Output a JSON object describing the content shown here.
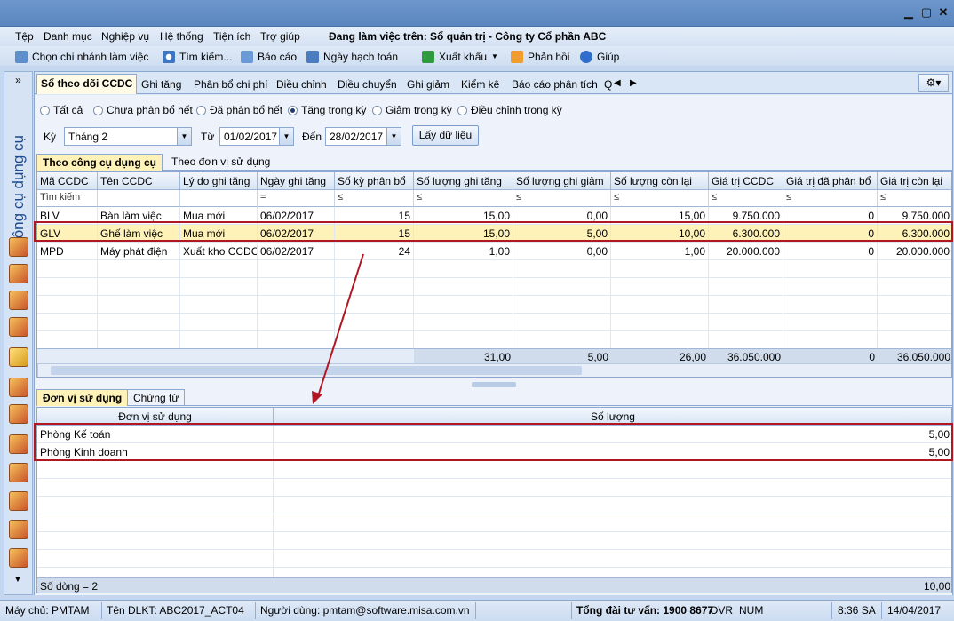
{
  "window": {
    "min": "▁",
    "max": "▢",
    "close": "✕"
  },
  "menu": {
    "items": [
      "Tệp",
      "Danh mục",
      "Nghiệp vụ",
      "Hệ thống",
      "Tiện ích",
      "Trợ giúp"
    ],
    "status": "Đang làm việc trên: Sổ quản trị - Công ty Cổ phần ABC"
  },
  "toolbar": {
    "branch": "Chọn chi nhánh làm việc",
    "search": "Tìm kiếm...",
    "report": "Báo cáo",
    "posting_date": "Ngày hạch toán",
    "export": "Xuất khẩu",
    "feedback": "Phản hồi",
    "help": "Giúp"
  },
  "left": {
    "title": "Công cụ dụng cụ",
    "collapse": "»"
  },
  "tabs": [
    "Sổ theo dõi CCDC",
    "Ghi tăng",
    "Phân bổ chi phí",
    "Điều chỉnh",
    "Điều chuyển",
    "Ghi giảm",
    "Kiểm kê",
    "Báo cáo phân tích",
    "Q"
  ],
  "filters": {
    "radios": [
      "Tất cả",
      "Chưa phân bổ hết",
      "Đã phân bổ hết",
      "Tăng trong kỳ",
      "Giảm trong kỳ",
      "Điều chỉnh trong kỳ"
    ],
    "selected": "Tăng trong kỳ",
    "period_label": "Kỳ",
    "period_value": "Tháng 2",
    "from_label": "Từ",
    "from_value": "01/02/2017",
    "to_label": "Đến",
    "to_value": "28/02/2017",
    "fetch_button": "Lấy dữ liệu"
  },
  "view_tabs": [
    "Theo công cụ dụng cụ",
    "Theo đơn vị sử dụng"
  ],
  "top_grid": {
    "headers": [
      "Mã CCDC",
      "Tên CCDC",
      "Lý do ghi tăng",
      "Ngày ghi tăng",
      "Số kỳ phân bổ",
      "Số lượng ghi tăng",
      "Số lượng ghi giảm",
      "Số lượng còn lại",
      "Giá trị CCDC",
      "Giá trị đã phân bổ",
      "Giá trị còn lại"
    ],
    "filter_row": [
      "Tìm kiếm",
      "",
      "",
      "=",
      "≤",
      "≤",
      "≤",
      "≤",
      "≤",
      "≤",
      "≤"
    ],
    "rows": [
      [
        "BLV",
        "Bàn làm việc",
        "Mua mới",
        "06/02/2017",
        "15",
        "15,00",
        "0,00",
        "15,00",
        "9.750.000",
        "0",
        "9.750.000"
      ],
      [
        "GLV",
        "Ghế làm việc",
        "Mua mới",
        "06/02/2017",
        "15",
        "15,00",
        "5,00",
        "10,00",
        "6.300.000",
        "0",
        "6.300.000"
      ],
      [
        "MPD",
        "Máy phát điện",
        "Xuất kho CCDC",
        "06/02/2017",
        "24",
        "1,00",
        "0,00",
        "1,00",
        "20.000.000",
        "0",
        "20.000.000"
      ]
    ],
    "selected_row": 1,
    "totals": [
      "",
      "",
      "",
      "",
      "",
      "31,00",
      "5,00",
      "26,00",
      "36.050.000",
      "0",
      "36.050.000"
    ]
  },
  "detail_tabs": [
    "Đơn vị sử dụng",
    "Chứng từ"
  ],
  "bottom_grid": {
    "headers": [
      "Đơn vị sử dụng",
      "Số lượng"
    ],
    "rows": [
      [
        "Phòng Kế toán",
        "5,00"
      ],
      [
        "Phòng Kinh doanh",
        "5,00"
      ]
    ],
    "footer_count": "Số dòng = 2",
    "footer_total": "10,00"
  },
  "statusbar": {
    "server": "Máy chủ: PMTAM",
    "db": "Tên DLKT: ABC2017_ACT04",
    "user": "Người dùng: pmtam@software.misa.com.vn",
    "hotline": "Tổng đài tư vấn: 1900 8677",
    "ovr": "OVR",
    "num": "NUM",
    "time": "8:36 SA",
    "date": "14/04/2017"
  },
  "colors": {
    "highlight": "#b01722",
    "selected_row": "#fff2b8",
    "accent": "#5a86bf"
  }
}
